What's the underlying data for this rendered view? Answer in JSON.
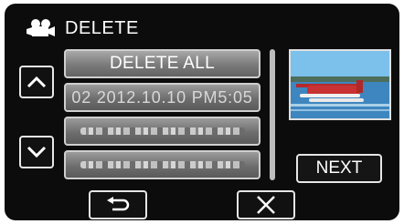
{
  "header": {
    "title": "DELETE",
    "icon": "movie-camera-icon"
  },
  "list": {
    "items": [
      {
        "label": "DELETE ALL",
        "kind": "action"
      },
      {
        "label": "02 2012.10.10 PM5:05",
        "kind": "file"
      },
      {
        "label": "",
        "kind": "blurred"
      },
      {
        "label": "",
        "kind": "blurred"
      }
    ]
  },
  "navigation": {
    "up_icon": "chevron-up-icon",
    "down_icon": "chevron-down-icon"
  },
  "buttons": {
    "next_label": "NEXT",
    "back_icon": "return-arrow-icon",
    "close_icon": "close-icon"
  }
}
